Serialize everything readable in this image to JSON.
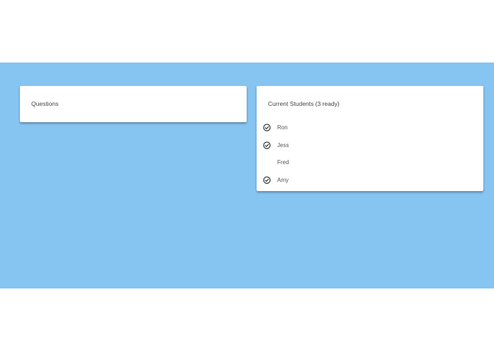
{
  "questions_card": {
    "title": "Questions"
  },
  "students_card": {
    "title": "Current Students (3 ready)",
    "students": [
      {
        "name": "Ron",
        "ready": true
      },
      {
        "name": "Jess",
        "ready": true
      },
      {
        "name": "Fred",
        "ready": false
      },
      {
        "name": "Amy",
        "ready": true
      }
    ]
  },
  "colors": {
    "background": "#86c4f2",
    "card": "#ffffff",
    "check": "#222222"
  },
  "icons": {
    "ready": "check-circle-icon"
  }
}
